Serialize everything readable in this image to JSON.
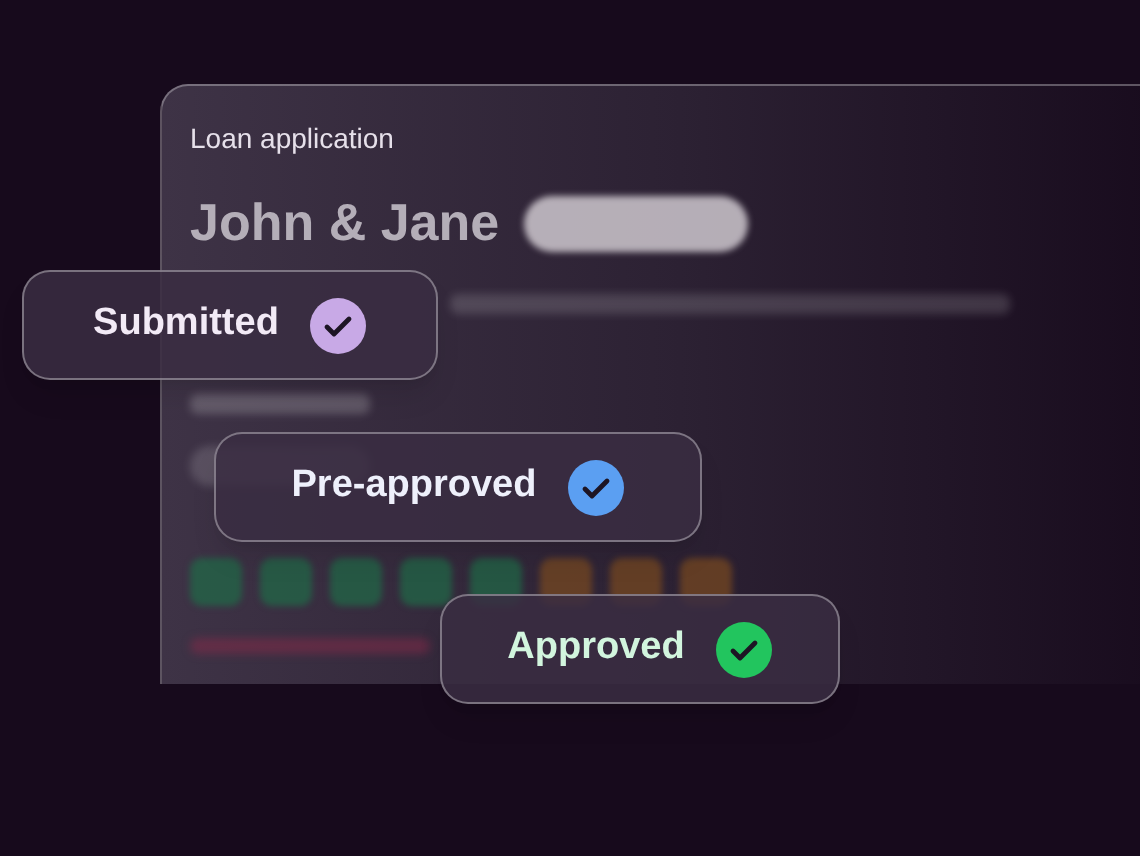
{
  "card": {
    "title": "Loan application",
    "name": "John & Jane"
  },
  "chips": [
    {
      "label": "Submitted",
      "color": "#c8a9e6"
    },
    {
      "label": "Pre-approved",
      "color": "#5b9ff2"
    },
    {
      "label": "Approved",
      "color": "#22c55e"
    }
  ]
}
